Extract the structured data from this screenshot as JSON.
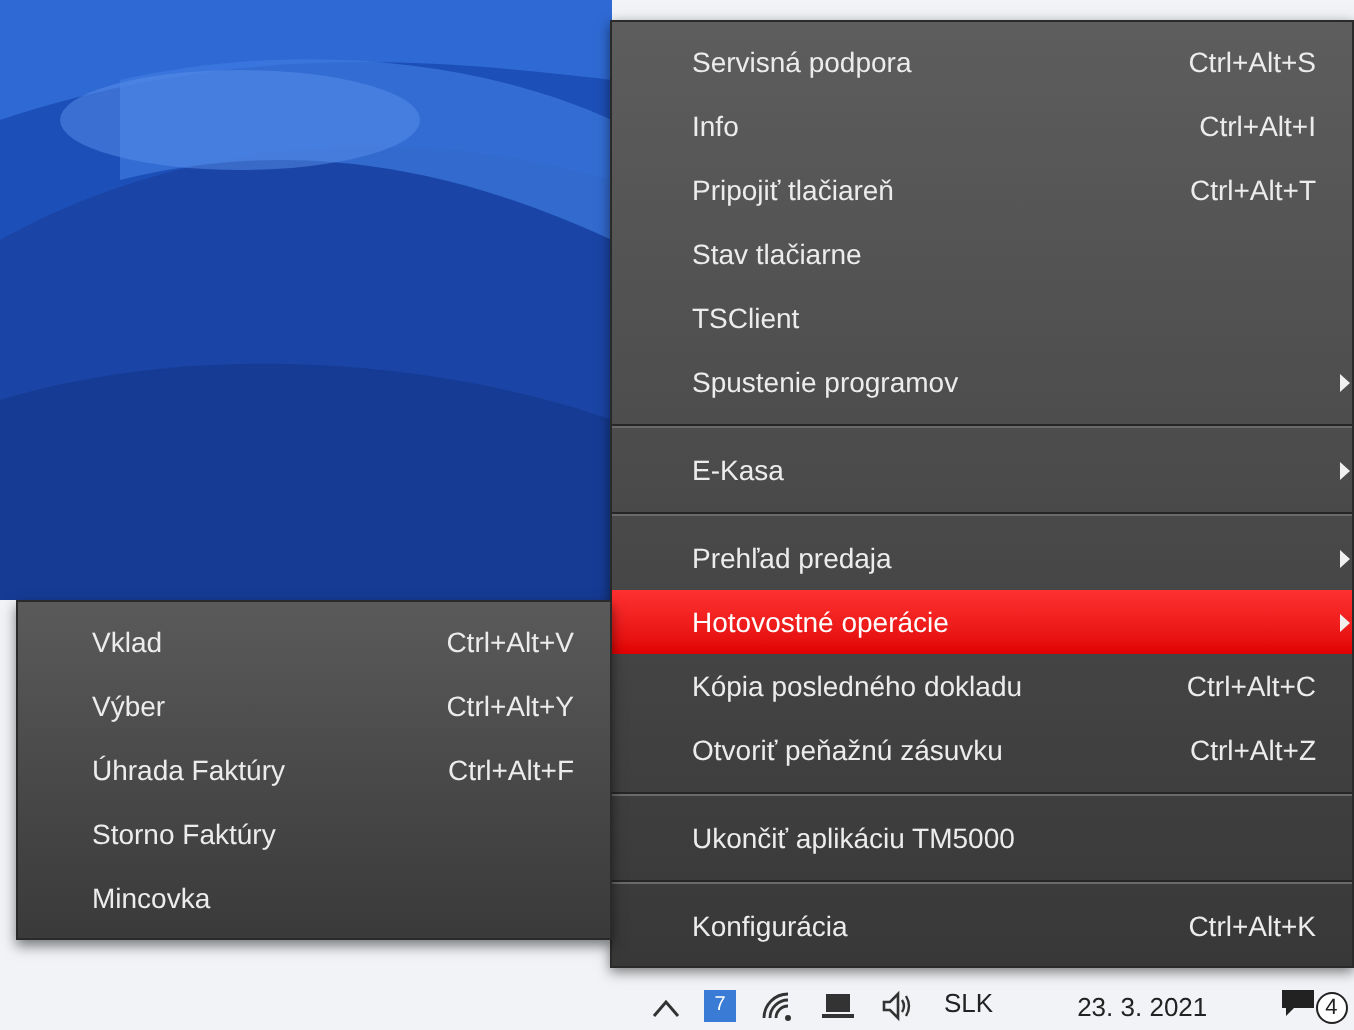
{
  "menu": {
    "items": [
      {
        "kind": "item",
        "label": "Servisná podpora",
        "shortcut": "Ctrl+Alt+S",
        "has_submenu": false,
        "selected": false
      },
      {
        "kind": "item",
        "label": "Info",
        "shortcut": "Ctrl+Alt+I",
        "has_submenu": false,
        "selected": false
      },
      {
        "kind": "item",
        "label": "Pripojiť tlačiareň",
        "shortcut": "Ctrl+Alt+T",
        "has_submenu": false,
        "selected": false
      },
      {
        "kind": "item",
        "label": "Stav tlačiarne",
        "has_submenu": false,
        "selected": false
      },
      {
        "kind": "item",
        "label": "TSClient",
        "has_submenu": false,
        "selected": false
      },
      {
        "kind": "item",
        "label": "Spustenie programov",
        "has_submenu": true,
        "selected": false
      },
      {
        "kind": "separator"
      },
      {
        "kind": "item",
        "label": "E-Kasa",
        "has_submenu": true,
        "selected": false
      },
      {
        "kind": "separator"
      },
      {
        "kind": "item",
        "label": "Prehľad predaja",
        "has_submenu": true,
        "selected": false
      },
      {
        "kind": "item",
        "label": "Hotovostné operácie",
        "has_submenu": true,
        "selected": true
      },
      {
        "kind": "item",
        "label": "Kópia posledného dokladu",
        "shortcut": "Ctrl+Alt+C",
        "has_submenu": false,
        "selected": false
      },
      {
        "kind": "item",
        "label": "Otvoriť peňažnú zásuvku",
        "shortcut": "Ctrl+Alt+Z",
        "has_submenu": false,
        "selected": false
      },
      {
        "kind": "separator"
      },
      {
        "kind": "item",
        "label": "Ukončiť aplikáciu TM5000",
        "has_submenu": false,
        "selected": false
      },
      {
        "kind": "separator"
      },
      {
        "kind": "item",
        "label": "Konfigurácia",
        "shortcut": "Ctrl+Alt+K",
        "has_submenu": false,
        "selected": false
      }
    ]
  },
  "submenu": {
    "items": [
      {
        "label": "Vklad",
        "shortcut": "Ctrl+Alt+V",
        "selected": false
      },
      {
        "label": "Výber",
        "shortcut": "Ctrl+Alt+Y",
        "selected": false
      },
      {
        "label": "Úhrada Faktúry",
        "shortcut": "Ctrl+Alt+F",
        "selected": false
      },
      {
        "label": "Storno Faktúry",
        "selected": false
      },
      {
        "label": "Mincovka",
        "selected": false
      }
    ]
  },
  "taskbar": {
    "language": "SLK",
    "date": "23. 3. 2021",
    "notifications": "4",
    "badge": "7"
  }
}
